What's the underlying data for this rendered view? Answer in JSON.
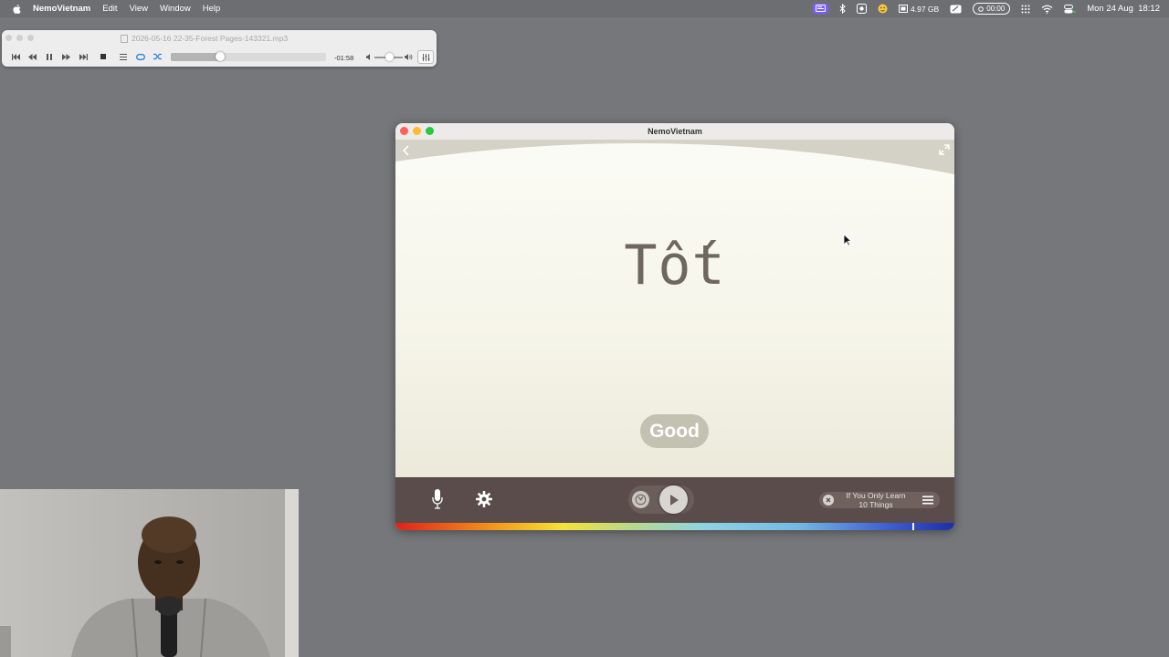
{
  "menubar": {
    "app_name": "NemoVietnam",
    "items": [
      "Edit",
      "View",
      "Window",
      "Help"
    ],
    "memory": "4.97 GB",
    "timer": "00:00",
    "datetime": "Mon 24 Aug  18:12"
  },
  "player": {
    "file_name": "2026-05-16 22-35-Forest Pages-143321.mp3",
    "remaining": "-01:58",
    "progress": 0.32,
    "volume": 0.4
  },
  "nemo": {
    "window_title": "NemoVietnam",
    "word": "Tốt",
    "translation": "Good",
    "lesson_title": "If You Only Learn\n10 Things",
    "progress_marker": 0.925
  },
  "colors": {
    "bottom_bar": "#5a4c4a",
    "translation_pill": "#c3c1b1",
    "word": "#6e6760"
  }
}
